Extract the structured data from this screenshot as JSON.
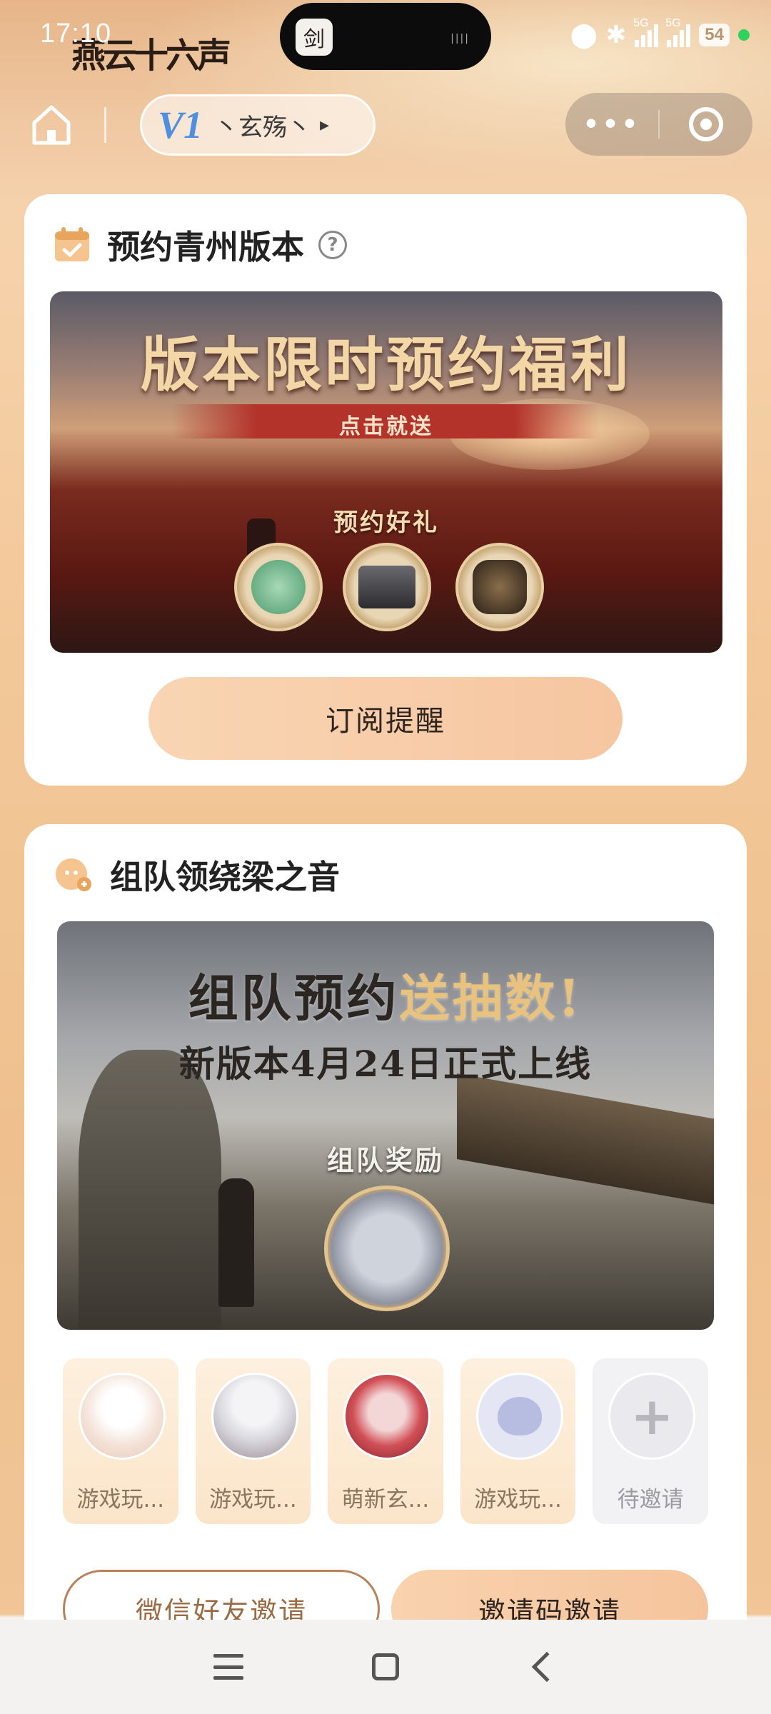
{
  "status_bar": {
    "time": "17:10",
    "brand_logo_text": "燕云十六声",
    "island_app_glyph": "剑",
    "network_1": "5G",
    "network_2": "5G",
    "battery": "54",
    "icons": [
      "location-icon",
      "bluetooth-icon",
      "signal-icon",
      "signal-icon",
      "battery-icon"
    ]
  },
  "top_nav": {
    "server_level": "V1",
    "server_name": "丶玄殇丶",
    "server_arrow": "▸",
    "more_label": "•••"
  },
  "reserve_card": {
    "title": "预约青州版本",
    "help_label": "?",
    "banner": {
      "headline": "版本限时预约福利",
      "subline": "点击就送",
      "gift_label": "预约好礼"
    },
    "subscribe_label": "订阅提醒"
  },
  "team_card": {
    "title": "组队领绕梁之音",
    "banner": {
      "headline_part1": "组队预约",
      "headline_part2": "送抽数!",
      "subline": "新版本4月24日正式上线",
      "reward_label": "组队奖励"
    },
    "members": [
      {
        "name": "游戏玩..."
      },
      {
        "name": "游戏玩..."
      },
      {
        "name": "萌新玄..."
      },
      {
        "name": "游戏玩..."
      },
      {
        "name": "待邀请"
      }
    ],
    "add_glyph": "+",
    "invite_wechat_label": "微信好友邀请",
    "invite_code_label": "邀请码邀请"
  },
  "colors": {
    "accent_peach": "#f6c6a0",
    "invite_outline": "#b8825a",
    "server_level_blue": "#4f8fe0"
  }
}
